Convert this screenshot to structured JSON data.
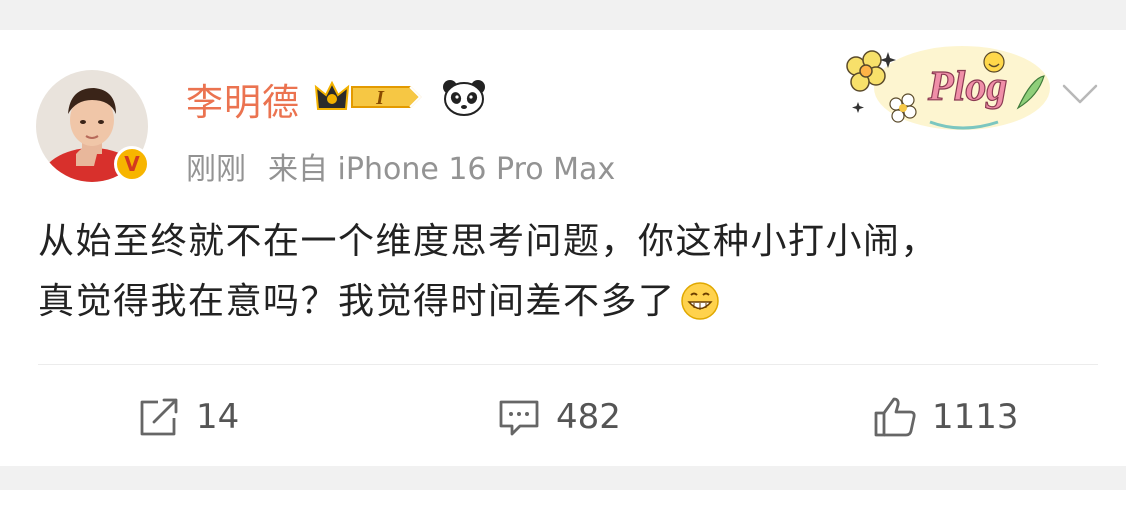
{
  "post": {
    "username": "李明德",
    "member_level": "I",
    "verified_mark": "V",
    "time": "刚刚",
    "source": "来自 iPhone 16 Pro Max",
    "decor_text": "Plog",
    "text_line1": "从始至终就不在一个维度思考问题，你这种小打小闹，",
    "text_line2": "真觉得我在意吗？我觉得时间差不多了",
    "emoji": "grinning-face-icon"
  },
  "actions": {
    "repost_count": "14",
    "comment_count": "482",
    "like_count": "1113"
  },
  "colors": {
    "username": "#eb7350",
    "meta": "#939393",
    "text": "#222222",
    "background": "#f1f1f1",
    "card": "#ffffff",
    "verified_badge": "#f7b500"
  }
}
